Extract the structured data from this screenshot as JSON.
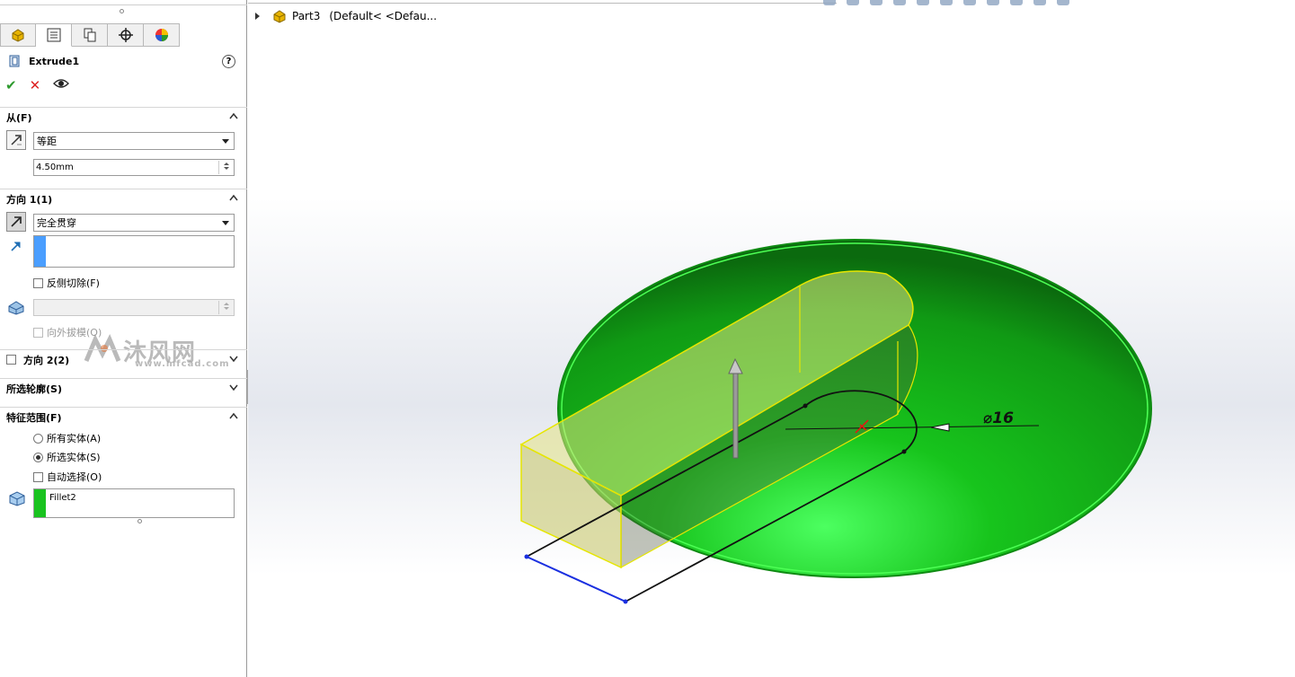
{
  "tree": {
    "part_label": "Part3",
    "config_label": "(Default< <Defau..."
  },
  "feature": {
    "title": "Extrude1",
    "help": "?"
  },
  "actions": {
    "ok_icon": "checkmark-icon",
    "cancel_icon": "x-icon",
    "preview_icon": "eye-icon"
  },
  "from": {
    "header": "从(F)",
    "type": "等距",
    "offset_value": "4.50mm"
  },
  "direction1": {
    "header": "方向 1(1)",
    "end_condition": "完全贯穿",
    "flip_side_cut": "反侧切除(F)",
    "draft_outward": "向外拔模(O)"
  },
  "direction2": {
    "header": "方向 2(2)"
  },
  "selected_contours": {
    "header": "所选轮廓(S)"
  },
  "feature_scope": {
    "header": "特征范围(F)",
    "all_bodies": "所有实体(A)",
    "selected_bodies": "所选实体(S)",
    "auto_select": "自动选择(O)",
    "body_item": "Fillet2"
  },
  "watermark": {
    "text": "沐风网",
    "url": "www.mfcad.com"
  },
  "model": {
    "dimension_label": "⌀16"
  },
  "colors": {
    "body_green": "#19b61f",
    "cut_yellow": "#e6e600",
    "selection_blue": "#4a9eff",
    "fillet_green": "#19c31f"
  }
}
